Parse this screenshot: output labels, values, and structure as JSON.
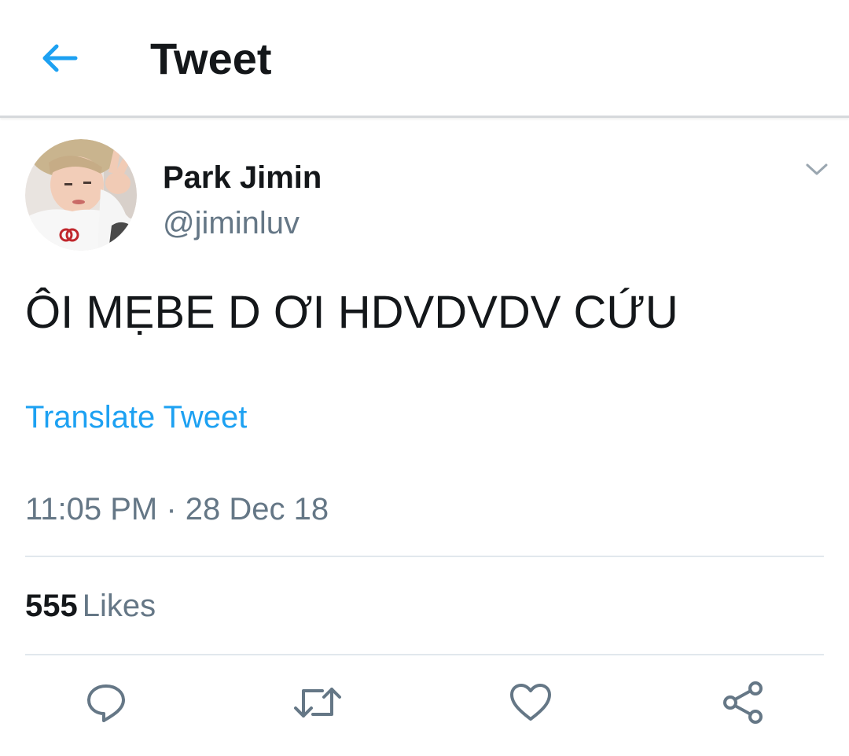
{
  "header": {
    "title": "Tweet",
    "back_icon": "arrow-left-icon"
  },
  "tweet": {
    "author": {
      "display_name": "Park Jimin",
      "handle": "@jiminluv",
      "avatar_icon": "avatar-photo"
    },
    "menu_icon": "chevron-down-icon",
    "text": "ÔI MẸBE D ƠI HDVDVDV CỨU",
    "translate_label": "Translate Tweet",
    "timestamp": "11:05 PM · 28 Dec 18",
    "likes_count": "555",
    "likes_label": "Likes"
  },
  "actions": [
    {
      "name": "reply",
      "icon": "reply-icon"
    },
    {
      "name": "retweet",
      "icon": "retweet-icon"
    },
    {
      "name": "like",
      "icon": "heart-icon"
    },
    {
      "name": "share",
      "icon": "share-icon"
    }
  ],
  "colors": {
    "accent": "#1da1f2",
    "text_primary": "#14171a",
    "text_secondary": "#657786",
    "divider": "#e1e8ed",
    "icon": "#657786"
  }
}
